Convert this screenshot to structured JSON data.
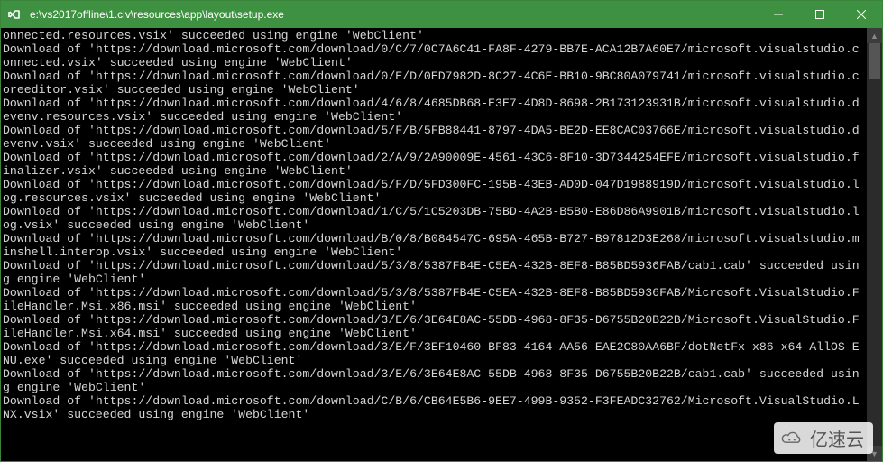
{
  "titlebar": {
    "icon_name": "vs-infinity-icon",
    "title": "e:\\vs2017offline\\1.civ\\resources\\app\\layout\\setup.exe",
    "minimize_label": "Minimize",
    "maximize_label": "Maximize",
    "close_label": "Close"
  },
  "scrollbar": {
    "up_glyph": "▲",
    "down_glyph": "▼"
  },
  "watermark": {
    "text": "亿速云"
  },
  "console_lines": [
    "onnected.resources.vsix' succeeded using engine 'WebClient'",
    "Download of 'https://download.microsoft.com/download/0/C/7/0C7A6C41-FA8F-4279-BB7E-ACA12B7A60E7/microsoft.visualstudio.connected.vsix' succeeded using engine 'WebClient'",
    "Download of 'https://download.microsoft.com/download/0/E/D/0ED7982D-8C27-4C6E-BB10-9BC80A079741/microsoft.visualstudio.coreeditor.vsix' succeeded using engine 'WebClient'",
    "Download of 'https://download.microsoft.com/download/4/6/8/4685DB68-E3E7-4D8D-8698-2B173123931B/microsoft.visualstudio.devenv.resources.vsix' succeeded using engine 'WebClient'",
    "Download of 'https://download.microsoft.com/download/5/F/B/5FB88441-8797-4DA5-BE2D-EE8CAC03766E/microsoft.visualstudio.devenv.vsix' succeeded using engine 'WebClient'",
    "Download of 'https://download.microsoft.com/download/2/A/9/2A90009E-4561-43C6-8F10-3D7344254EFE/microsoft.visualstudio.finalizer.vsix' succeeded using engine 'WebClient'",
    "Download of 'https://download.microsoft.com/download/5/F/D/5FD300FC-195B-43EB-AD0D-047D1988919D/microsoft.visualstudio.log.resources.vsix' succeeded using engine 'WebClient'",
    "Download of 'https://download.microsoft.com/download/1/C/5/1C5203DB-75BD-4A2B-B5B0-E86D86A9901B/microsoft.visualstudio.log.vsix' succeeded using engine 'WebClient'",
    "Download of 'https://download.microsoft.com/download/B/0/8/B084547C-695A-465B-B727-B97812D3E268/microsoft.visualstudio.minshell.interop.vsix' succeeded using engine 'WebClient'",
    "Download of 'https://download.microsoft.com/download/5/3/8/5387FB4E-C5EA-432B-8EF8-B85BD5936FAB/cab1.cab' succeeded using engine 'WebClient'",
    "Download of 'https://download.microsoft.com/download/5/3/8/5387FB4E-C5EA-432B-8EF8-B85BD5936FAB/Microsoft.VisualStudio.FileHandler.Msi.x86.msi' succeeded using engine 'WebClient'",
    "Download of 'https://download.microsoft.com/download/3/E/6/3E64E8AC-55DB-4968-8F35-D6755B20B22B/Microsoft.VisualStudio.FileHandler.Msi.x64.msi' succeeded using engine 'WebClient'",
    "Download of 'https://download.microsoft.com/download/3/E/F/3EF10460-BF83-4164-AA56-EAE2C80AA6BF/dotNetFx-x86-x64-AllOS-ENU.exe' succeeded using engine 'WebClient'",
    "Download of 'https://download.microsoft.com/download/3/E/6/3E64E8AC-55DB-4968-8F35-D6755B20B22B/cab1.cab' succeeded using engine 'WebClient'",
    "Download of 'https://download.microsoft.com/download/C/B/6/CB64E5B6-9EE7-499B-9352-F3FEADC32762/Microsoft.VisualStudio.LNX.vsix' succeeded using engine 'WebClient'"
  ]
}
